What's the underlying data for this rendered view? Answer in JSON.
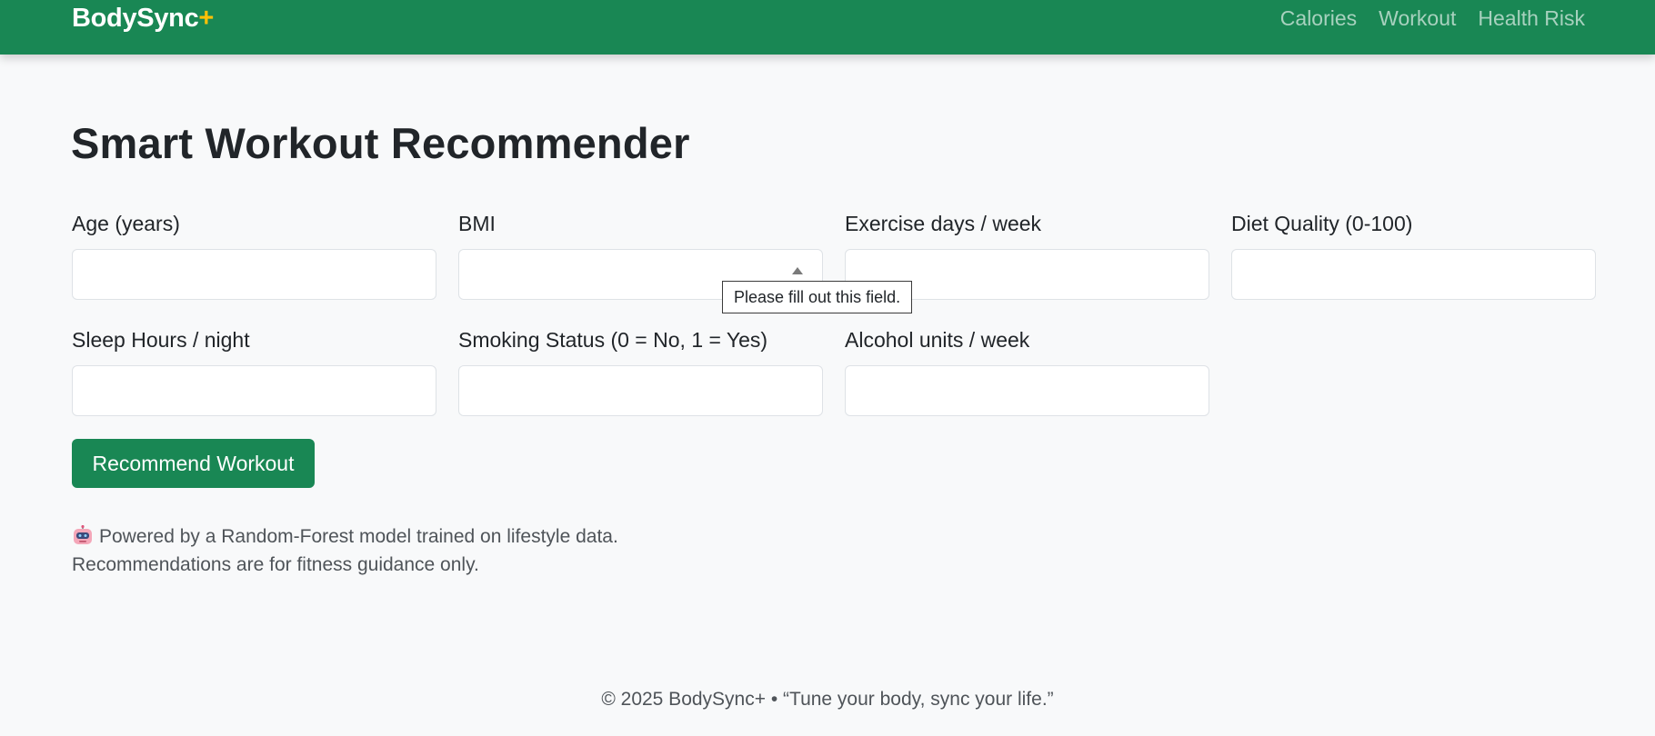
{
  "navbar": {
    "brand_name": "BodySync",
    "brand_plus": "+",
    "links": [
      "Calories",
      "Workout",
      "Health Risk"
    ]
  },
  "main": {
    "title": "Smart Workout Recommender",
    "fields": [
      {
        "label": "Age (years)",
        "value": ""
      },
      {
        "label": "BMI",
        "value": ""
      },
      {
        "label": "Exercise days / week",
        "value": ""
      },
      {
        "label": "Diet Quality (0-100)",
        "value": ""
      },
      {
        "label": "Sleep Hours / night",
        "value": ""
      },
      {
        "label": "Smoking Status (0 = No, 1 = Yes)",
        "value": ""
      },
      {
        "label": "Alcohol units / week",
        "value": ""
      }
    ],
    "validation_tooltip": "Please fill out this field.",
    "submit_label": "Recommend Workout",
    "note_icon": "robot-icon",
    "note_line1": "Powered by a Random-Forest model trained on lifestyle data.",
    "note_line2": "Recommendations are for fitness guidance only."
  },
  "footer": {
    "text": "© 2025 BodySync+ • “Tune your body, sync your life.”"
  },
  "colors": {
    "brand_green": "#198754",
    "brand_accent": "#ffc107",
    "page_background": "#f8f9fa"
  }
}
